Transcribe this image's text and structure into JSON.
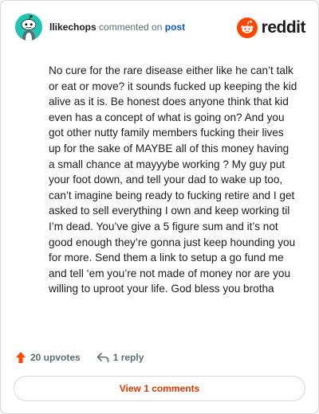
{
  "comment": {
    "username": "llikechops",
    "commented_on": "commented on",
    "post_link": "post",
    "body": "No cure for the rare disease either like he can’t talk or eat or move? it sounds fucked up keeping the kid alive as it is. Be honest does anyone think that kid even has a concept of what is going on? And you got other nutty family members fucking their lives up for the sake of MAYBE all of this money having a small chance at mayyybe working ? My guy put your foot down, and tell your dad to wake up too, can’t imagine being ready to fucking retire and I get asked to sell everything I own and keep working til I’m dead. You’ve give a 5 figure sum and it’s not good enough they’re gonna just keep hounding you for more. Send them a link to setup a go fund me and tell ‘em you’re not made of money nor are you willing to uproot your life. God bless you brotha",
    "upvotes": "20 upvotes",
    "replies": "1 reply",
    "view_comments_label": "View 1 comments"
  },
  "brand": {
    "wordmark": "reddit",
    "accent_color": "#ff4500"
  },
  "icons": {
    "avatar": "snoo-avatar-icon",
    "logo": "reddit-logo-icon",
    "upvote": "upvote-arrow-icon",
    "reply": "reply-arrow-icon"
  }
}
